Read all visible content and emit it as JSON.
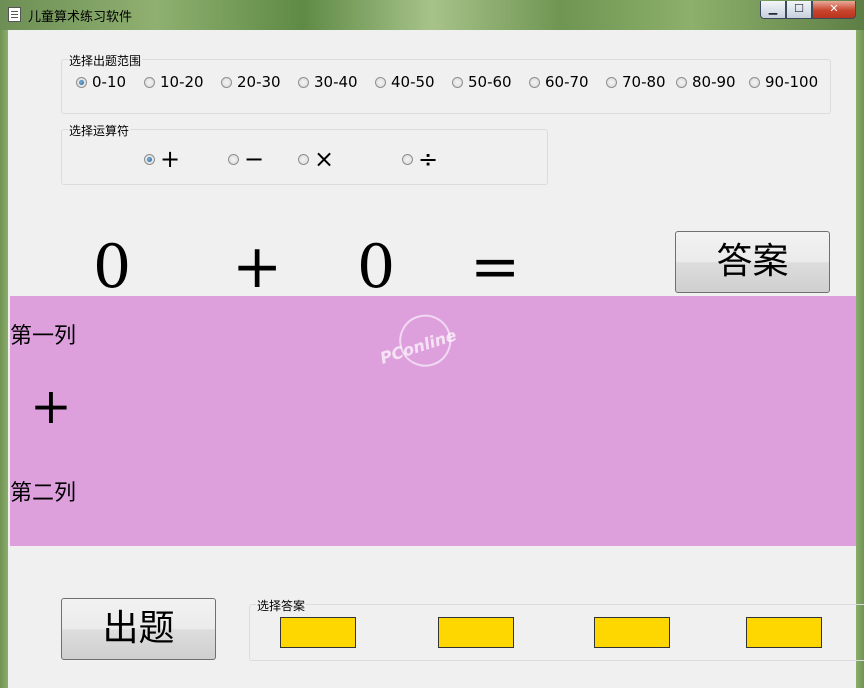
{
  "window": {
    "title": "儿童算术练习软件"
  },
  "range_group": {
    "legend": "选择出题范围",
    "options": [
      "0-10",
      "10-20",
      "20-30",
      "30-40",
      "40-50",
      "50-60",
      "60-70",
      "70-80",
      "80-90",
      "90-100"
    ],
    "selected": "0-10"
  },
  "operator_group": {
    "legend": "选择运算符",
    "options": [
      "+",
      "−",
      "×",
      "÷"
    ],
    "selected": "+"
  },
  "equation": {
    "left": "0",
    "operator": "+",
    "right": "0",
    "equals": "="
  },
  "answer_button": "答案",
  "panel": {
    "first_col": "第一列",
    "operator": "+",
    "second_col": "第二列",
    "color": "#dda0dd"
  },
  "watermark": "PConline",
  "question_button": "出题",
  "answer_group": {
    "legend": "选择答案",
    "choice_color": "#ffd700"
  }
}
